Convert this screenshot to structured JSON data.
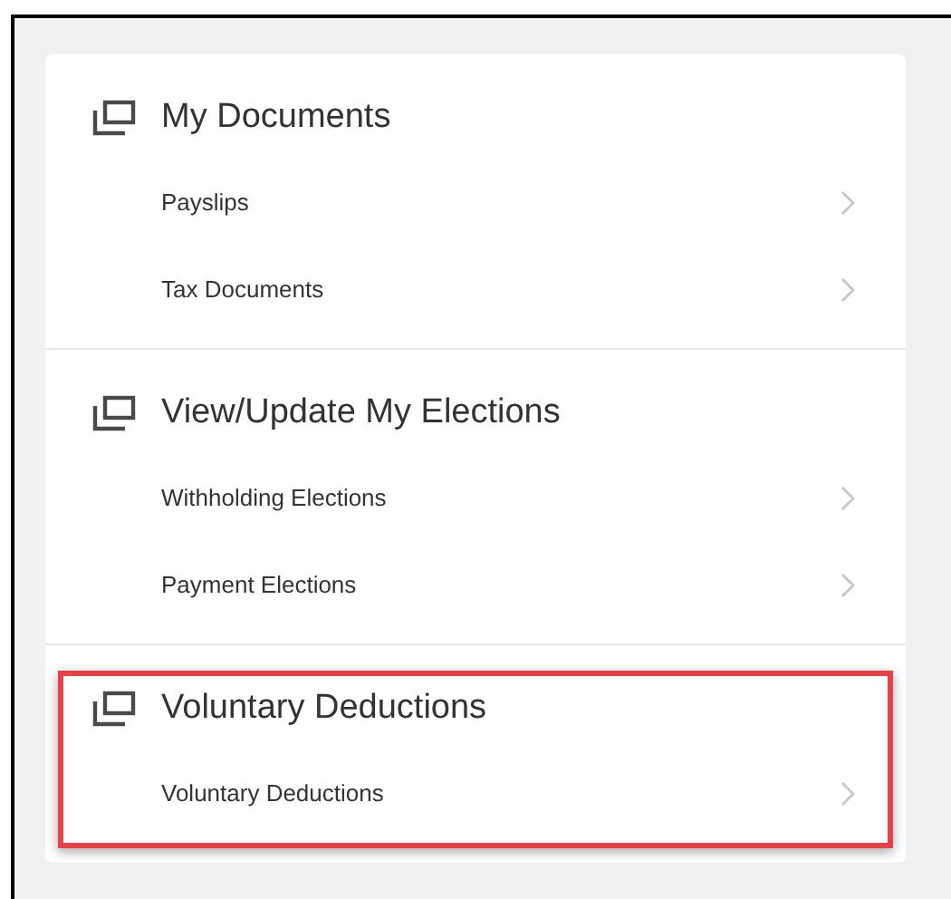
{
  "sections": [
    {
      "title": "My Documents",
      "highlighted": false,
      "items": [
        {
          "label": "Payslips"
        },
        {
          "label": "Tax Documents"
        }
      ]
    },
    {
      "title": "View/Update My Elections",
      "highlighted": false,
      "items": [
        {
          "label": "Withholding Elections"
        },
        {
          "label": "Payment Elections"
        }
      ]
    },
    {
      "title": "Voluntary Deductions",
      "highlighted": true,
      "items": [
        {
          "label": "Voluntary Deductions"
        }
      ]
    }
  ]
}
